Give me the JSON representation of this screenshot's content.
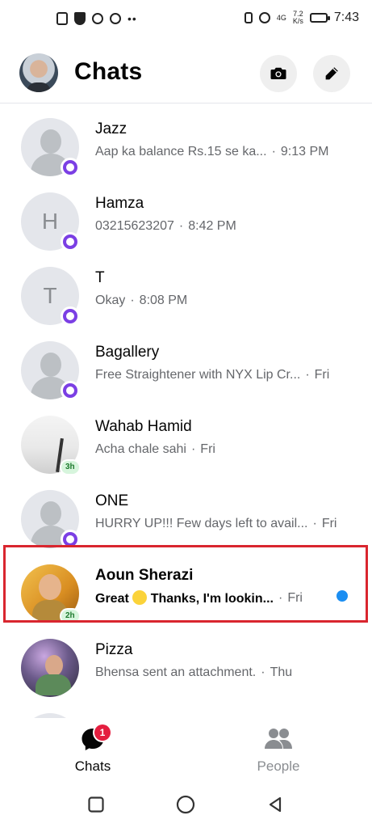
{
  "status_bar": {
    "network_speed_value": "7.2",
    "network_speed_unit": "K/s",
    "network_type": "4G",
    "time": "7:43"
  },
  "header": {
    "title": "Chats"
  },
  "chats": [
    {
      "name": "Jazz",
      "preview": "Aap ka balance Rs.15 se ka...",
      "time": "9:13 PM",
      "avatar": "placeholder",
      "indicator": "status-ring",
      "unread": false
    },
    {
      "name": "Hamza",
      "preview": "03215623207",
      "time": "8:42 PM",
      "avatar": "letter",
      "avatar_letter": "H",
      "indicator": "status-ring",
      "unread": false
    },
    {
      "name": "T",
      "preview": "Okay",
      "time": "8:08 PM",
      "avatar": "letter",
      "avatar_letter": "T",
      "indicator": "status-ring",
      "unread": false
    },
    {
      "name": "Bagallery",
      "preview": "Free Straightener with NYX Lip Cr...",
      "time": "Fri",
      "avatar": "placeholder",
      "indicator": "status-ring",
      "unread": false
    },
    {
      "name": "Wahab Hamid",
      "preview": "Acha chale sahi",
      "time": "Fri",
      "avatar": "photo",
      "indicator": "time-badge",
      "badge_text": "3h",
      "unread": false
    },
    {
      "name": "ONE",
      "preview": "HURRY UP!!! Few days left to avail...",
      "time": "Fri",
      "avatar": "placeholder",
      "indicator": "status-ring",
      "unread": false
    },
    {
      "name": "Aoun Sherazi",
      "preview_before_emoji": "Great",
      "preview_after_emoji": "Thanks, I'm lookin...",
      "time": "Fri",
      "avatar": "photo",
      "indicator": "time-badge",
      "badge_text": "2h",
      "unread": true
    },
    {
      "name": "Pizza",
      "preview": "Bhensa sent an attachment.",
      "time": "Thu",
      "avatar": "photo",
      "unread": false
    }
  ],
  "bottom_nav": {
    "chats_label": "Chats",
    "chats_badge": "1",
    "people_label": "People"
  },
  "colors": {
    "status_ring": "#7b3fe4",
    "unread_dot": "#1b8ef2",
    "badge_red": "#e41e3f",
    "highlight_border": "#d9262f"
  }
}
